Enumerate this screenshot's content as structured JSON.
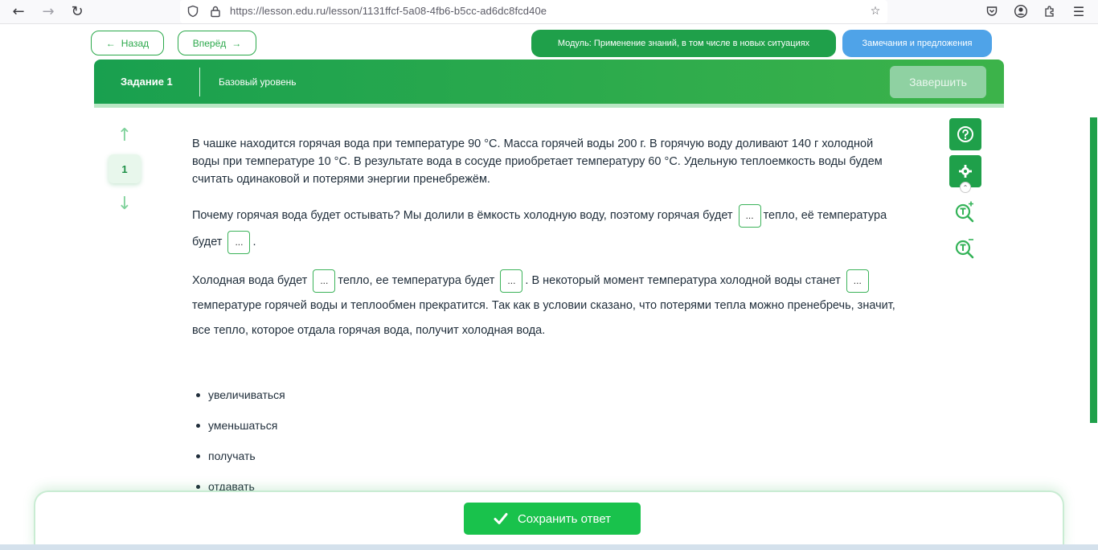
{
  "browser": {
    "url": "https://lesson.edu.ru/lesson/1131ffcf-5a08-4fb6-b5cc-ad6dc8fcd40e"
  },
  "nav": {
    "back_label": "Назад",
    "forward_label": "Вперёд",
    "module_label": "Модуль: Применение знаний, в том числе в новых ситуациях",
    "notes_label": "Замечания и предложения"
  },
  "task": {
    "number_label": "Задание 1",
    "level_label": "Базовый уровень",
    "finish_label": "Завершить",
    "question_number": "1"
  },
  "text": {
    "p1": "В чашке находится горячая вода при температуре 90 °С. Масса горячей воды 200 г. В горячую воду доливают 140 г холодной воды при температуре 10 °С. В результате вода в сосуде приобретает температуру 60 °С. Удельную теплоемкость воды будем считать одинаковой и потерями энергии пренебрежём.",
    "p2_a": "Почему горячая вода будет остывать? Мы долили в ёмкость холодную воду, поэтому горячая будет",
    "p2_b": "тепло, её температура будет",
    "p2_c": ".",
    "p3_a": "Холодная вода будет",
    "p3_b": "тепло, ее температура будет",
    "p3_c": ". В некоторый момент температура холодной воды станет",
    "p3_d": "температуре горячей воды и теплообмен прекратится. Так как в условии сказано, что потерями тепла можно пренебречь, значит, все тепло, которое отдала горячая вода, получит холодная вода.",
    "blank_placeholder": "..."
  },
  "options": [
    "увеличиваться",
    "уменьшаться",
    "получать",
    "отдавать"
  ],
  "save": {
    "label": "Сохранить ответ"
  },
  "colors": {
    "primary_green": "#1fa04a",
    "save_green": "#19c24c",
    "notes_blue": "#4fa3e8"
  }
}
